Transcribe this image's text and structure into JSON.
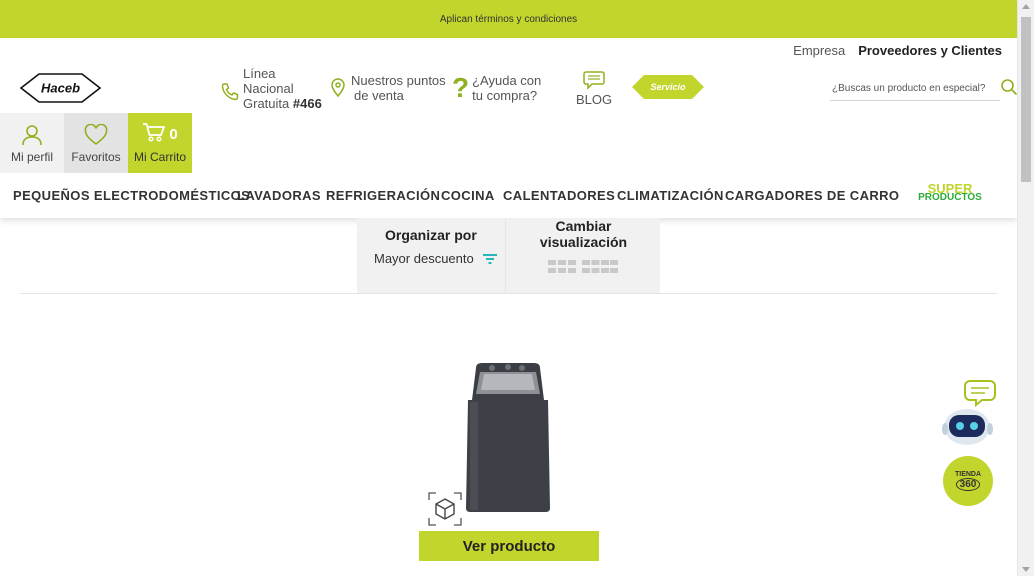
{
  "promo": {
    "text": "Aplican términos y condiciones"
  },
  "top_links": {
    "empresa": "Empresa",
    "proveedores": "Proveedores y Clientes"
  },
  "logo": {
    "text": "Haceb"
  },
  "contact": {
    "linea_1": "Línea",
    "linea_2": "Nacional",
    "linea_3": "Gratuita",
    "linea_number": "#466",
    "puntos_1": "Nuestros puntos",
    "puntos_2": "de venta",
    "ayuda_1": "¿Ayuda con",
    "ayuda_2": "tu compra?",
    "blog": "BLOG",
    "servicio": "Servicio"
  },
  "search": {
    "placeholder": "¿Buscas un producto en especial?"
  },
  "account": {
    "perfil": "Mi perfil",
    "favoritos": "Favoritos",
    "carrito": "Mi Carrito",
    "cart_count": "0"
  },
  "nav": {
    "items": [
      "PEQUEÑOS ELECTRODOMÉSTICOS",
      "LAVADORAS",
      "REFRIGERACIÓN",
      "COCINA",
      "CALENTADORES",
      "CLIMATIZACIÓN",
      "CARGADORES DE CARRO"
    ],
    "super_1": "SUPER",
    "super_2": "PRODUCTOS"
  },
  "filters": {
    "organizar_title": "Organizar por",
    "organizar_value": "Mayor descuento",
    "visual_title_1": "Cambiar",
    "visual_title_2": "visualización"
  },
  "product": {
    "button": "Ver producto"
  },
  "tienda": {
    "line1": "TIENDA",
    "line2": "360"
  },
  "colors": {
    "brand_green": "#c2d52c",
    "super_green": "#2cab3a",
    "teal_icon": "#2bb5b8"
  }
}
